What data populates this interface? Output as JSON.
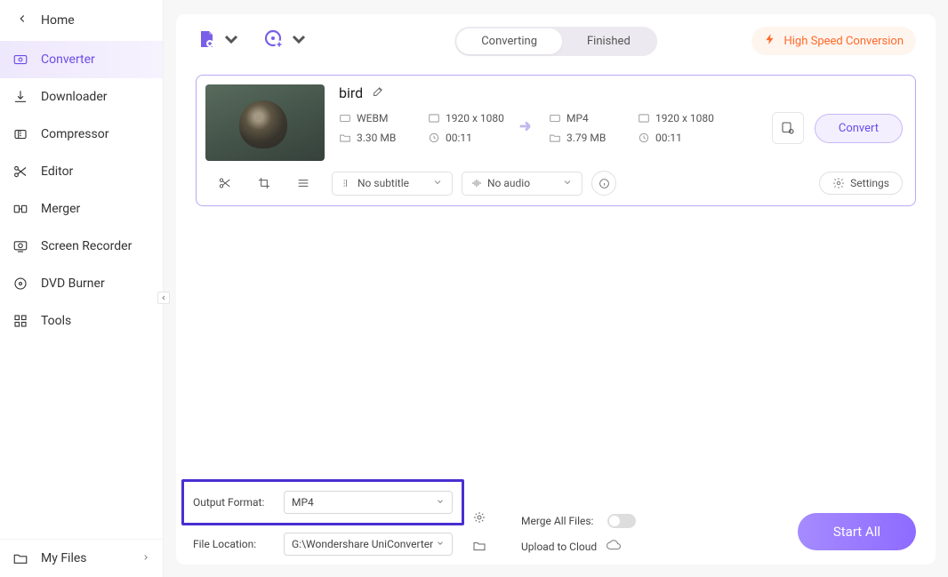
{
  "sidebar": {
    "home": "Home",
    "items": [
      {
        "label": "Converter"
      },
      {
        "label": "Downloader"
      },
      {
        "label": "Compressor"
      },
      {
        "label": "Editor"
      },
      {
        "label": "Merger"
      },
      {
        "label": "Screen Recorder"
      },
      {
        "label": "DVD Burner"
      },
      {
        "label": "Tools"
      }
    ],
    "my_files": "My Files"
  },
  "top": {
    "tabs": {
      "converting": "Converting",
      "finished": "Finished"
    },
    "hsc": "High Speed Conversion"
  },
  "file": {
    "title": "bird",
    "src": {
      "format": "WEBM",
      "res": "1920 x 1080",
      "size": "3.30 MB",
      "dur": "00:11"
    },
    "dst": {
      "format": "MP4",
      "res": "1920 x 1080",
      "size": "3.79 MB",
      "dur": "00:11"
    },
    "convert": "Convert",
    "subtitle": "No subtitle",
    "audio": "No audio",
    "settings": "Settings"
  },
  "bottom": {
    "output_format_label": "Output Format:",
    "output_format_value": "MP4",
    "file_location_label": "File Location:",
    "file_location_value": "G:\\Wondershare UniConverter",
    "merge_label": "Merge All Files:",
    "upload_label": "Upload to Cloud",
    "start_all": "Start All"
  }
}
